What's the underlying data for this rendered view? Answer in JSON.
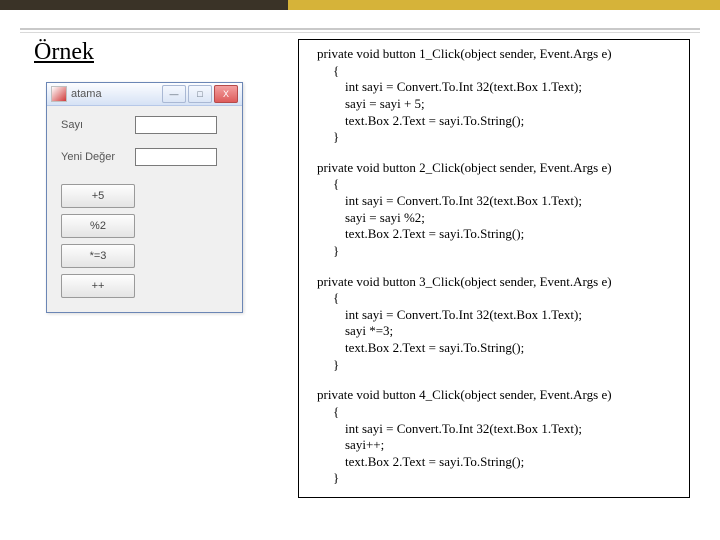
{
  "slide": {
    "title": "Örnek"
  },
  "window": {
    "title": "atama",
    "controls": {
      "min": "—",
      "max": "□",
      "close": "X"
    },
    "labels": {
      "sayi": "Sayı",
      "yeni_deger": "Yeni Değer"
    },
    "buttons": [
      {
        "label": "+5"
      },
      {
        "label": "%2"
      },
      {
        "label": "*=3"
      },
      {
        "label": "++"
      }
    ]
  },
  "code": {
    "blocks": [
      {
        "sig": "private void button 1_Click(object sender, Event.Args e)",
        "lines": [
          "int sayi = Convert.To.Int 32(text.Box 1.Text);",
          "sayi = sayi + 5;",
          "text.Box 2.Text = sayi.To.String();"
        ]
      },
      {
        "sig": "private void button 2_Click(object sender, Event.Args e)",
        "lines": [
          "int sayi = Convert.To.Int 32(text.Box 1.Text);",
          "sayi = sayi %2;",
          "text.Box 2.Text = sayi.To.String();"
        ]
      },
      {
        "sig": "private void button 3_Click(object sender, Event.Args e)",
        "lines": [
          "int sayi = Convert.To.Int 32(text.Box 1.Text);",
          "sayi *=3;",
          "text.Box 2.Text = sayi.To.String();"
        ]
      },
      {
        "sig": "private void button 4_Click(object sender, Event.Args e)",
        "lines": [
          "int sayi = Convert.To.Int 32(text.Box 1.Text);",
          "sayi++;",
          "text.Box 2.Text = sayi.To.String();"
        ]
      }
    ]
  }
}
